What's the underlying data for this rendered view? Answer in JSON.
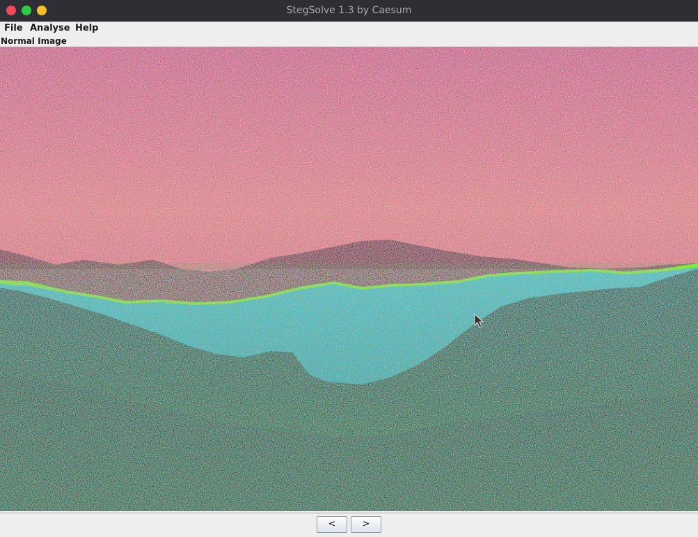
{
  "window": {
    "title": "StegSolve 1.3 by Caesum"
  },
  "menu": {
    "file": "File",
    "analyse": "Analyse",
    "help": "Help"
  },
  "viewer": {
    "mode_label": "Normal Image"
  },
  "navigation": {
    "prev_label": "<",
    "next_label": ">"
  },
  "colors": {
    "titlebar": "#2d2f34",
    "sky_pink": "#c85a86",
    "sky_peach": "#e8a07a",
    "ridge_dark": "#7a3a4e",
    "ridge_green_edge": "#7ee832",
    "mid_cyan": "#3fb2b0",
    "forest_dark": "#1f6a5a",
    "forest_green": "#2f8a4a"
  }
}
